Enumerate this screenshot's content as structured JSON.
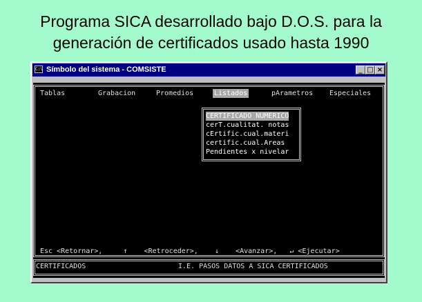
{
  "caption": {
    "line1": "Programa SICA desarrollado bajo D.O.S. para la",
    "line2": "generación de certificados usado hasta 1990"
  },
  "window": {
    "title": "Símbolo del sistema - COMSISTE",
    "icon": "console-icon",
    "controls": {
      "minimize": "_",
      "maximize": "□",
      "close": "×"
    }
  },
  "menubar": {
    "items": [
      "Tablas",
      "Grabacion",
      "Promedios",
      "Listados",
      "pArametros",
      "Especiales"
    ],
    "active": "Listados"
  },
  "dropdown": {
    "items": [
      "CERTIFICADO NUMERICO",
      "cerT.cualitat. notas",
      "cErtific.cual.materi",
      "certific.cual.Areas",
      "Pendientes x nivelar"
    ],
    "selected_index": 0
  },
  "keys": {
    "esc": "Esc",
    "esc_label": "<Retornar>,",
    "up_icon": "↑",
    "up_label": "<Retroceder>,",
    "down_icon": "↓",
    "down_label": "<Avanzar>,",
    "enter_icon": "↵",
    "enter_label": "<Ejecutar>"
  },
  "statusbar": {
    "left": "CERTIFICADOS",
    "center": "I.E. PASOS DATOS A SICA CERTIFICADOS"
  },
  "colors": {
    "page_background": "#a3fbcd",
    "titlebar": "#000080",
    "console_background": "#000000",
    "console_text": "#c0c0c0",
    "highlight": "#a8a8a8"
  }
}
